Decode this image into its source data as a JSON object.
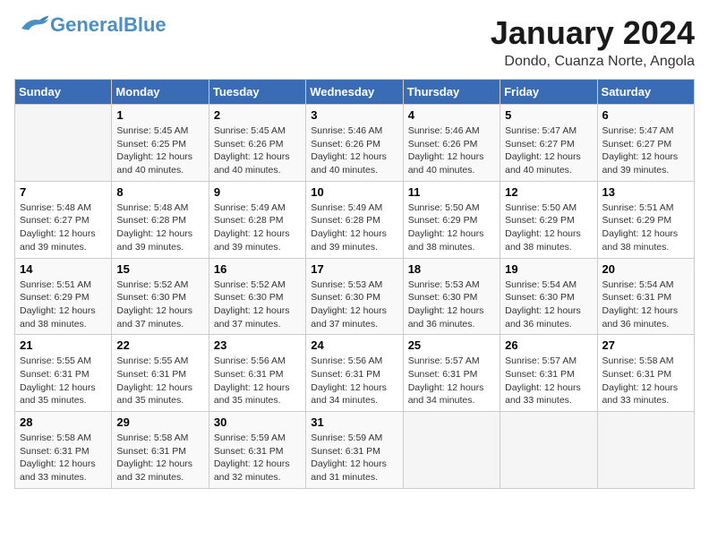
{
  "header": {
    "logo_general": "General",
    "logo_blue": "Blue",
    "month": "January 2024",
    "location": "Dondo, Cuanza Norte, Angola"
  },
  "days_of_week": [
    "Sunday",
    "Monday",
    "Tuesday",
    "Wednesday",
    "Thursday",
    "Friday",
    "Saturday"
  ],
  "weeks": [
    [
      {
        "day": "",
        "info": ""
      },
      {
        "day": "1",
        "info": "Sunrise: 5:45 AM\nSunset: 6:25 PM\nDaylight: 12 hours\nand 40 minutes."
      },
      {
        "day": "2",
        "info": "Sunrise: 5:45 AM\nSunset: 6:26 PM\nDaylight: 12 hours\nand 40 minutes."
      },
      {
        "day": "3",
        "info": "Sunrise: 5:46 AM\nSunset: 6:26 PM\nDaylight: 12 hours\nand 40 minutes."
      },
      {
        "day": "4",
        "info": "Sunrise: 5:46 AM\nSunset: 6:26 PM\nDaylight: 12 hours\nand 40 minutes."
      },
      {
        "day": "5",
        "info": "Sunrise: 5:47 AM\nSunset: 6:27 PM\nDaylight: 12 hours\nand 40 minutes."
      },
      {
        "day": "6",
        "info": "Sunrise: 5:47 AM\nSunset: 6:27 PM\nDaylight: 12 hours\nand 39 minutes."
      }
    ],
    [
      {
        "day": "7",
        "info": "Sunrise: 5:48 AM\nSunset: 6:27 PM\nDaylight: 12 hours\nand 39 minutes."
      },
      {
        "day": "8",
        "info": "Sunrise: 5:48 AM\nSunset: 6:28 PM\nDaylight: 12 hours\nand 39 minutes."
      },
      {
        "day": "9",
        "info": "Sunrise: 5:49 AM\nSunset: 6:28 PM\nDaylight: 12 hours\nand 39 minutes."
      },
      {
        "day": "10",
        "info": "Sunrise: 5:49 AM\nSunset: 6:28 PM\nDaylight: 12 hours\nand 39 minutes."
      },
      {
        "day": "11",
        "info": "Sunrise: 5:50 AM\nSunset: 6:29 PM\nDaylight: 12 hours\nand 38 minutes."
      },
      {
        "day": "12",
        "info": "Sunrise: 5:50 AM\nSunset: 6:29 PM\nDaylight: 12 hours\nand 38 minutes."
      },
      {
        "day": "13",
        "info": "Sunrise: 5:51 AM\nSunset: 6:29 PM\nDaylight: 12 hours\nand 38 minutes."
      }
    ],
    [
      {
        "day": "14",
        "info": "Sunrise: 5:51 AM\nSunset: 6:29 PM\nDaylight: 12 hours\nand 38 minutes."
      },
      {
        "day": "15",
        "info": "Sunrise: 5:52 AM\nSunset: 6:30 PM\nDaylight: 12 hours\nand 37 minutes."
      },
      {
        "day": "16",
        "info": "Sunrise: 5:52 AM\nSunset: 6:30 PM\nDaylight: 12 hours\nand 37 minutes."
      },
      {
        "day": "17",
        "info": "Sunrise: 5:53 AM\nSunset: 6:30 PM\nDaylight: 12 hours\nand 37 minutes."
      },
      {
        "day": "18",
        "info": "Sunrise: 5:53 AM\nSunset: 6:30 PM\nDaylight: 12 hours\nand 36 minutes."
      },
      {
        "day": "19",
        "info": "Sunrise: 5:54 AM\nSunset: 6:30 PM\nDaylight: 12 hours\nand 36 minutes."
      },
      {
        "day": "20",
        "info": "Sunrise: 5:54 AM\nSunset: 6:31 PM\nDaylight: 12 hours\nand 36 minutes."
      }
    ],
    [
      {
        "day": "21",
        "info": "Sunrise: 5:55 AM\nSunset: 6:31 PM\nDaylight: 12 hours\nand 35 minutes."
      },
      {
        "day": "22",
        "info": "Sunrise: 5:55 AM\nSunset: 6:31 PM\nDaylight: 12 hours\nand 35 minutes."
      },
      {
        "day": "23",
        "info": "Sunrise: 5:56 AM\nSunset: 6:31 PM\nDaylight: 12 hours\nand 35 minutes."
      },
      {
        "day": "24",
        "info": "Sunrise: 5:56 AM\nSunset: 6:31 PM\nDaylight: 12 hours\nand 34 minutes."
      },
      {
        "day": "25",
        "info": "Sunrise: 5:57 AM\nSunset: 6:31 PM\nDaylight: 12 hours\nand 34 minutes."
      },
      {
        "day": "26",
        "info": "Sunrise: 5:57 AM\nSunset: 6:31 PM\nDaylight: 12 hours\nand 33 minutes."
      },
      {
        "day": "27",
        "info": "Sunrise: 5:58 AM\nSunset: 6:31 PM\nDaylight: 12 hours\nand 33 minutes."
      }
    ],
    [
      {
        "day": "28",
        "info": "Sunrise: 5:58 AM\nSunset: 6:31 PM\nDaylight: 12 hours\nand 33 minutes."
      },
      {
        "day": "29",
        "info": "Sunrise: 5:58 AM\nSunset: 6:31 PM\nDaylight: 12 hours\nand 32 minutes."
      },
      {
        "day": "30",
        "info": "Sunrise: 5:59 AM\nSunset: 6:31 PM\nDaylight: 12 hours\nand 32 minutes."
      },
      {
        "day": "31",
        "info": "Sunrise: 5:59 AM\nSunset: 6:31 PM\nDaylight: 12 hours\nand 31 minutes."
      },
      {
        "day": "",
        "info": ""
      },
      {
        "day": "",
        "info": ""
      },
      {
        "day": "",
        "info": ""
      }
    ]
  ]
}
